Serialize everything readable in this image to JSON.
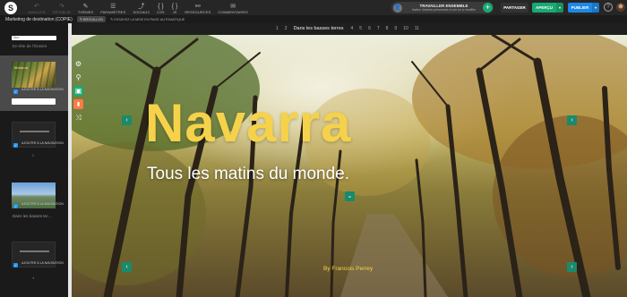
{
  "app": {
    "logo": "S"
  },
  "toolbar": {
    "tools": [
      {
        "icon": "↶",
        "label": "ANNULER",
        "dim": true,
        "name": "undo"
      },
      {
        "icon": "↷",
        "label": "RÉTABLIR",
        "dim": true,
        "name": "redo"
      },
      {
        "icon": "✎",
        "label": "THÈMES",
        "dim": false,
        "name": "themes"
      },
      {
        "icon": "☰",
        "label": "PARAMÈTRES",
        "dim": false,
        "name": "settings"
      },
      {
        "icon": "⤴",
        "label": "SOCIAUX",
        "dim": false,
        "name": "social"
      },
      {
        "icon": "{ }",
        "label": "CSS",
        "dim": false,
        "name": "css"
      },
      {
        "icon": "{ }",
        "label": "JS",
        "dim": false,
        "name": "js"
      },
      {
        "icon": "⚯",
        "label": "RESSOURCES",
        "dim": false,
        "name": "resources"
      },
      {
        "icon": "✉",
        "label": "COMMENTAIRES",
        "dim": false,
        "name": "comments"
      }
    ],
    "collab_title": "TRAVAILLER ENSEMBLE",
    "collab_sub": "Invitez d'autres personnes à voir ou à modifier",
    "collab_plus": "+",
    "share": "PARTAGER",
    "preview": "APERÇU",
    "publish": "PUBLIER",
    "dropdown": "▾",
    "help": "?"
  },
  "subbar": {
    "title": "Marketing de destination (COPIE)",
    "draft": "✎ BROUILLON",
    "autopage": "✎ ESSAYEZ LA MISE EN PAGE AUTOMATIQUE"
  },
  "left": {
    "search_value": "Non",
    "section": "En-tête de l'histoire",
    "collapse": "≡",
    "slides": [
      {
        "thumb_title": "Navarra",
        "check": "AJOUTER À LA NAVIGATION",
        "caption": "",
        "num": ""
      },
      {
        "check": "AJOUTER À LA NAVIGATION",
        "caption": "",
        "num": "2"
      },
      {
        "check": "AJOUTER À LA NAVIGATION",
        "caption": "Dans les basses ter…",
        "num": ""
      },
      {
        "check": "AJOUTER À LA NAVIGATION",
        "caption": "",
        "num": "4"
      }
    ]
  },
  "sidetools": [
    "⚙",
    "⚲",
    "▣",
    "▮",
    "⤨"
  ],
  "stage": {
    "pager": [
      "1",
      "2",
      "Dans les basses terres",
      "4",
      "5",
      "6",
      "7",
      "8",
      "9",
      "10",
      "11"
    ],
    "title": "Navarra",
    "subtitle": "Tous les matins du monde.",
    "byline": "By Francois Perrey",
    "arrow_left": "‹",
    "arrow_right": "›",
    "arrow_down": "⌄"
  },
  "colors": {
    "accent_green": "#19a974",
    "publish_blue": "#1e88e5",
    "title_yellow": "#f6d24a"
  }
}
